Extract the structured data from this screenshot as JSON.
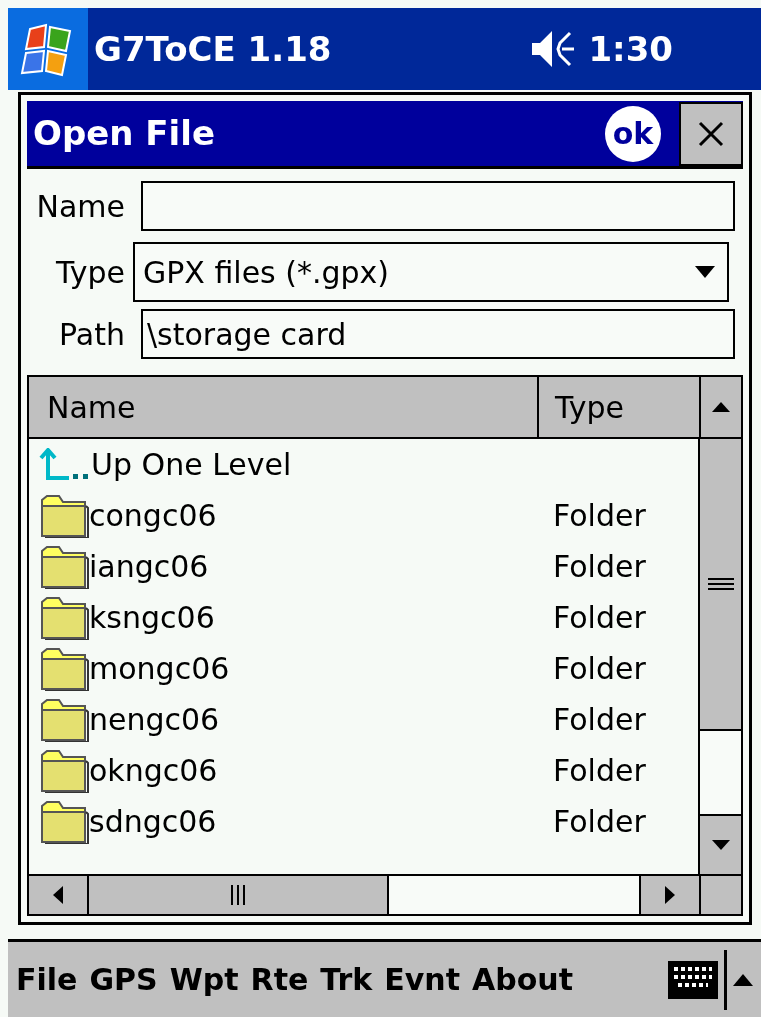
{
  "status_bar": {
    "app_title": "G7ToCE 1.18",
    "time": "1:30"
  },
  "dialog": {
    "title": "Open File",
    "ok_button": "ok",
    "fields": [
      {
        "label": "Name",
        "kind": "text"
      },
      {
        "label": "Type",
        "value": "GPX files (*.gpx)",
        "kind": "dropdown"
      },
      {
        "label": "Path",
        "value": "\\storage card",
        "kind": "text"
      }
    ],
    "file_list": {
      "columns": [
        "Name",
        "Type"
      ],
      "rows": [
        {
          "name": "Up One Level",
          "kind": "up"
        },
        {
          "name": "congc06",
          "type": "Folder",
          "kind": "folder"
        },
        {
          "name": "iangc06",
          "type": "Folder",
          "kind": "folder"
        },
        {
          "name": "ksngc06",
          "type": "Folder",
          "kind": "folder"
        },
        {
          "name": "mongc06",
          "type": "Folder",
          "kind": "folder"
        },
        {
          "name": "nengc06",
          "type": "Folder",
          "kind": "folder"
        },
        {
          "name": "okngc06",
          "type": "Folder",
          "kind": "folder"
        },
        {
          "name": "sdngc06",
          "type": "Folder",
          "kind": "folder"
        }
      ]
    }
  },
  "menu_bar": {
    "items": [
      "File",
      "GPS",
      "Wpt",
      "Rte",
      "Trk",
      "Evnt",
      "About"
    ]
  }
}
